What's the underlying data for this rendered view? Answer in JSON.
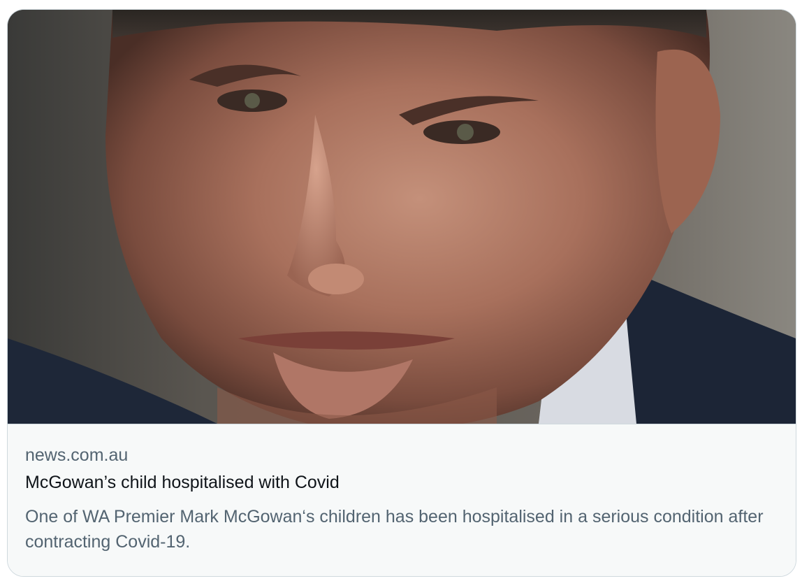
{
  "card": {
    "domain": "news.com.au",
    "title": "McGowan’s child hospitalised with Covid",
    "description": "One of WA Premier Mark McGowan‘s children has been hospitalised in a serious condition after contracting Covid-19."
  },
  "image": {
    "subject": "close-up portrait of a man's face"
  },
  "colors": {
    "border": "#cfd9de",
    "meta_background": "#f7f9f9",
    "secondary_text": "#536471",
    "primary_text": "#0f1419"
  }
}
